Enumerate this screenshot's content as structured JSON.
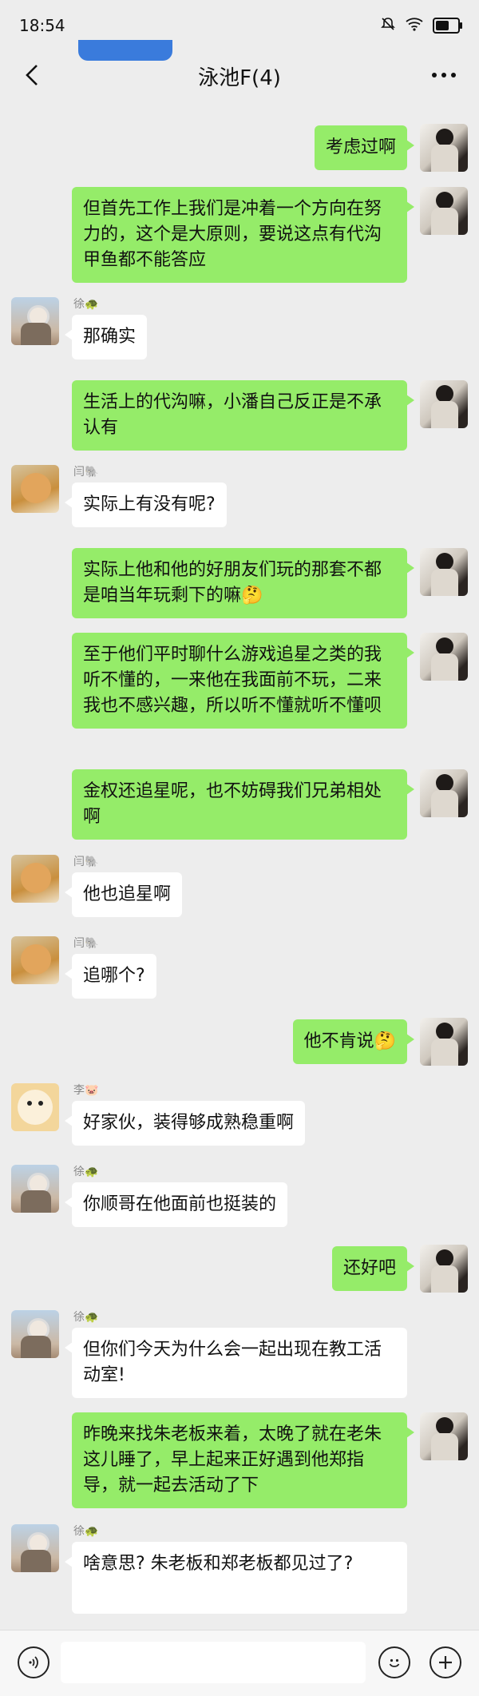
{
  "status_bar": {
    "time": "18:54",
    "wifi_icon": "wifi-icon",
    "mute_icon": "mute-icon",
    "battery_icon": "battery-icon"
  },
  "header": {
    "title": "泳池F(4)",
    "back_icon": "chevron-left-icon",
    "more_icon": "more-icon"
  },
  "senders": {
    "xu": "徐🐢",
    "yan": "闫🐘",
    "li": "李🐷"
  },
  "messages": [
    {
      "from": "me",
      "text": "考虑过啊"
    },
    {
      "from": "me",
      "text": "但首先工作上我们是冲着一个方向在努力的，这个是大原则，要说这点有代沟甲鱼都不能答应"
    },
    {
      "from": "xu",
      "text": "那确实"
    },
    {
      "from": "me",
      "text": "生活上的代沟嘛，小潘自己反正是不承认有"
    },
    {
      "from": "yan",
      "text": "实际上有没有呢?"
    },
    {
      "from": "me",
      "text": "实际上他和他的好朋友们玩的那套不都是咱当年玩剩下的嘛🤔"
    },
    {
      "from": "me",
      "text": "至于他们平时聊什么游戏追星之类的我听不懂的，一来他在我面前不玩，二来我也不感兴趣，所以听不懂就听不懂呗"
    },
    {
      "from": "me",
      "text": "金权还追星呢，也不妨碍我们兄弟相处啊"
    },
    {
      "from": "yan",
      "text": "他也追星啊"
    },
    {
      "from": "yan",
      "text": "追哪个?"
    },
    {
      "from": "me",
      "text": "他不肯说🤔"
    },
    {
      "from": "li",
      "text": "好家伙，装得够成熟稳重啊"
    },
    {
      "from": "xu",
      "text": "你顺哥在他面前也挺装的"
    },
    {
      "from": "me",
      "text": "还好吧"
    },
    {
      "from": "xu",
      "text": "但你们今天为什么会一起出现在教工活动室!"
    },
    {
      "from": "me",
      "text": "昨晚来找朱老板来着，太晚了就在老朱这儿睡了，早上起来正好遇到他郑指导，就一起去活动了下"
    },
    {
      "from": "xu",
      "text": "啥意思? 朱老板和郑老板都见过了?"
    }
  ],
  "input_bar": {
    "voice_icon": "voice-icon",
    "emoji_icon": "emoji-icon",
    "plus_icon": "plus-icon"
  }
}
